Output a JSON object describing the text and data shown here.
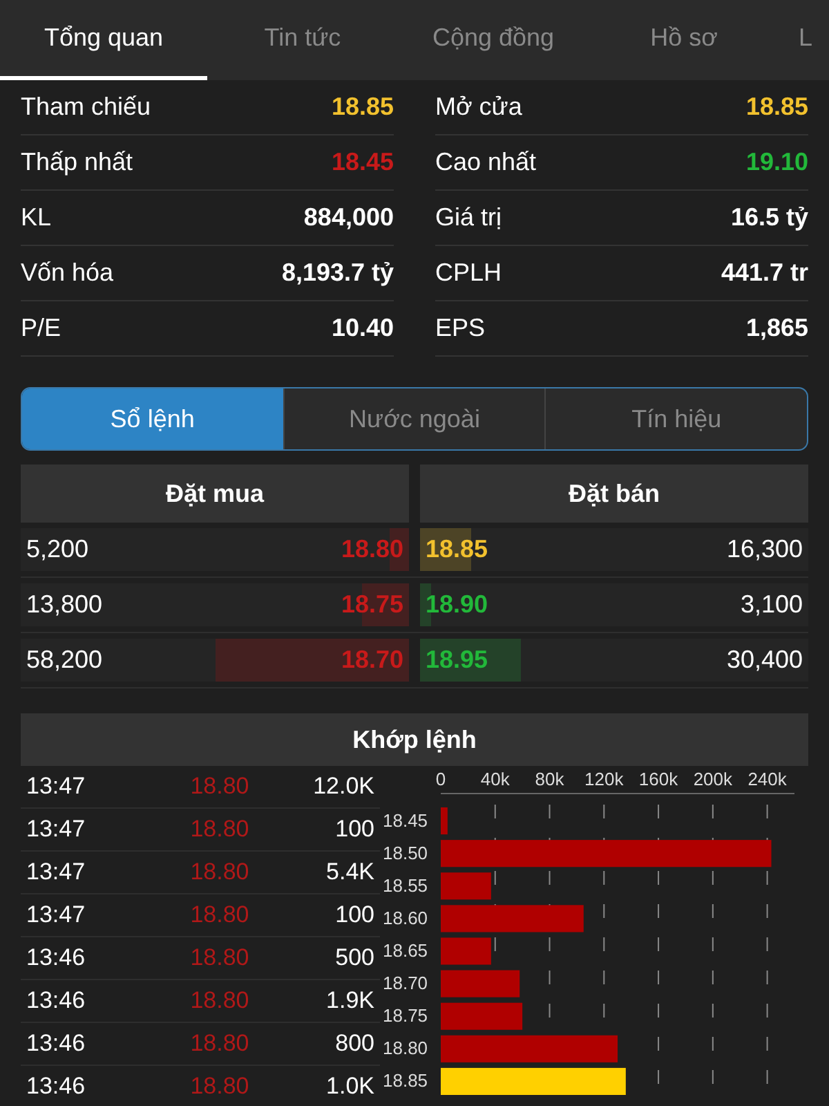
{
  "tabs": [
    {
      "label": "Tổng quan",
      "selected": true
    },
    {
      "label": "Tin tức",
      "selected": false
    },
    {
      "label": "Cộng đồng",
      "selected": false
    },
    {
      "label": "Hồ sơ",
      "selected": false
    },
    {
      "label": "L",
      "selected": false
    }
  ],
  "stats": [
    {
      "label": "Tham chiếu",
      "value": "18.85",
      "color": "#f2c12e"
    },
    {
      "label": "Mở cửa",
      "value": "18.85",
      "color": "#f2c12e"
    },
    {
      "label": "Thấp nhất",
      "value": "18.45",
      "color": "#c81a1a"
    },
    {
      "label": "Cao nhất",
      "value": "19.10",
      "color": "#22b83a"
    },
    {
      "label": "KL",
      "value": "884,000",
      "color": "#ffffff"
    },
    {
      "label": "Giá trị",
      "value": "16.5 tỷ",
      "color": "#ffffff"
    },
    {
      "label": "Vốn hóa",
      "value": "8,193.7 tỷ",
      "color": "#ffffff"
    },
    {
      "label": "CPLH",
      "value": "441.7 tr",
      "color": "#ffffff"
    },
    {
      "label": "P/E",
      "value": "10.40",
      "color": "#ffffff"
    },
    {
      "label": "EPS",
      "value": "1,865",
      "color": "#ffffff"
    }
  ],
  "segments": [
    {
      "label": "Sổ lệnh",
      "selected": true
    },
    {
      "label": "Nước ngoài",
      "selected": false
    },
    {
      "label": "Tín hiệu",
      "selected": false
    }
  ],
  "order_book": {
    "buy_header": "Đặt mua",
    "sell_header": "Đặt bán",
    "rows": [
      {
        "buy": {
          "volume": "5,200",
          "price": "18.80",
          "color": "#c81a1a",
          "level": 0.05
        },
        "sell": {
          "price": "18.85",
          "color": "#f2c12e",
          "level": 0.13,
          "volume": "16,300"
        }
      },
      {
        "buy": {
          "volume": "13,800",
          "price": "18.75",
          "color": "#c81a1a",
          "level": 0.12
        },
        "sell": {
          "price": "18.90",
          "color": "#22b83a",
          "level": 0.03,
          "volume": "3,100"
        }
      },
      {
        "buy": {
          "volume": "58,200",
          "price": "18.70",
          "color": "#c81a1a",
          "level": 0.5
        },
        "sell": {
          "price": "18.95",
          "color": "#22b83a",
          "level": 0.26,
          "volume": "30,400"
        }
      }
    ]
  },
  "matched": {
    "title": "Khớp lệnh",
    "trades": [
      {
        "time": "13:47",
        "price": "18.80",
        "color": "#b01818",
        "volume": "12.0K"
      },
      {
        "time": "13:47",
        "price": "18.80",
        "color": "#b01818",
        "volume": "100"
      },
      {
        "time": "13:47",
        "price": "18.80",
        "color": "#b01818",
        "volume": "5.4K"
      },
      {
        "time": "13:47",
        "price": "18.80",
        "color": "#b01818",
        "volume": "100"
      },
      {
        "time": "13:46",
        "price": "18.80",
        "color": "#b01818",
        "volume": "500"
      },
      {
        "time": "13:46",
        "price": "18.80",
        "color": "#b01818",
        "volume": "1.9K"
      },
      {
        "time": "13:46",
        "price": "18.80",
        "color": "#b01818",
        "volume": "800"
      },
      {
        "time": "13:46",
        "price": "18.80",
        "color": "#b01818",
        "volume": "1.0K"
      }
    ],
    "chart_data": {
      "type": "bar",
      "orientation": "horizontal",
      "stacked": true,
      "grid": true,
      "categories": [
        "18.45",
        "18.50",
        "18.55",
        "18.60",
        "18.65",
        "18.70",
        "18.75",
        "18.80",
        "18.85"
      ],
      "series": [
        {
          "color": "#b00000",
          "values": [
            5000,
            243000,
            37000,
            105000,
            37000,
            58000,
            60000,
            130000,
            null
          ]
        },
        {
          "color": "#ffd000",
          "values": [
            null,
            null,
            null,
            null,
            null,
            null,
            null,
            null,
            136000
          ]
        }
      ],
      "xlim": [
        0,
        260000
      ],
      "xticks": [
        {
          "value": 0,
          "label": "0"
        },
        {
          "value": 40000,
          "label": "40k"
        },
        {
          "value": 80000,
          "label": "80k"
        },
        {
          "value": 120000,
          "label": "120k"
        },
        {
          "value": 160000,
          "label": "160k"
        },
        {
          "value": 200000,
          "label": "200k"
        },
        {
          "value": 240000,
          "label": "240k"
        }
      ]
    }
  }
}
